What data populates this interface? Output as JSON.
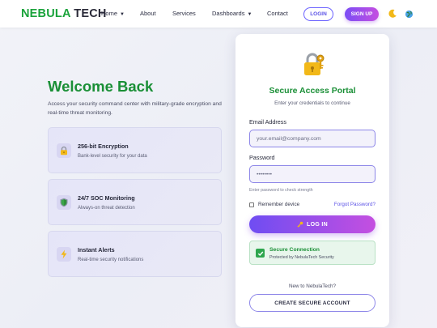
{
  "nav": {
    "brand_part1": "NEBULA",
    "brand_part2": " TECH",
    "links": [
      {
        "label": "Home",
        "caret": "▼"
      },
      {
        "label": "About"
      },
      {
        "label": "Services"
      },
      {
        "label": "Dashboards",
        "caret": "▼"
      },
      {
        "label": "Contact"
      }
    ],
    "login_label": "LOGIN",
    "signup_label": "SIGN UP",
    "icons": [
      "moon-icon",
      "globe-icon"
    ]
  },
  "hero": {
    "title": "Welcome Back",
    "description": "Access your security command center with military-grade encryption and real-time threat monitoring."
  },
  "features": [
    {
      "icon": "lock-icon",
      "title": "256-bit Encryption",
      "desc": "Bank-level security for your data"
    },
    {
      "icon": "shield-icon",
      "title": "24/7 SOC Monitoring",
      "desc": "Always-on threat detection"
    },
    {
      "icon": "lightning-icon",
      "title": "Instant Alerts",
      "desc": "Real-time security notifications"
    }
  ],
  "portal": {
    "icon": "lock-key-icon",
    "title": "Secure Access Portal",
    "subtitle": "Enter your credentials to continue",
    "email_label": "Email Address",
    "email_placeholder": "your.email@company.com",
    "password_label": "Password",
    "password_value": "••••••••",
    "password_hint": "Enter password to check strength",
    "remember_label": "Remember device",
    "forgot_label": "Forgot Password?",
    "login_button": "LOG IN",
    "secure_title": "Secure Connection",
    "secure_desc": "Protected by NebulaTech Security",
    "new_to": "New to NebulaTech?",
    "create_button": "CREATE SECURE ACCOUNT"
  },
  "colors": {
    "accent_green": "#1a8f36",
    "accent_purple": "#6f4df2",
    "accent_pink": "#c44fe0"
  }
}
